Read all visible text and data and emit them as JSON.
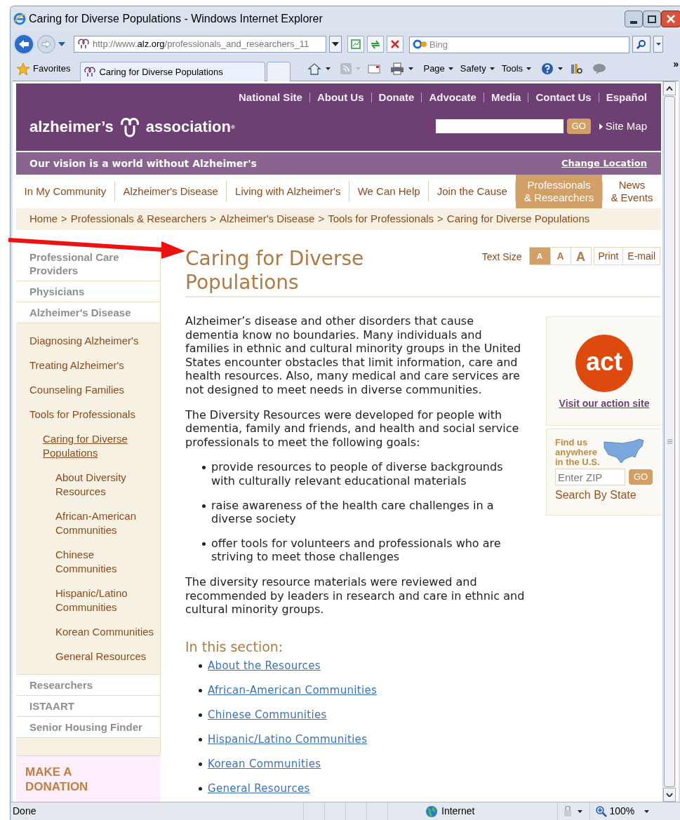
{
  "browser": {
    "title": "Caring for Diverse Populations - Windows Internet Explorer",
    "address_host": "http://www.",
    "address_domain": "alz.org",
    "address_path": "/professionals_and_researchers_11",
    "search_placeholder": "Bing",
    "favorites": "Favorites",
    "tab": "Caring for Diverse Populations",
    "menus": [
      "Page",
      "Safety",
      "Tools"
    ],
    "overflow": "»"
  },
  "header": {
    "top_links": [
      "National Site",
      "About Us",
      "Donate",
      "Advocate",
      "Media",
      "Contact Us",
      "Español"
    ],
    "logo_left": "alzheimer’s",
    "logo_right": "association",
    "logo_mark": "®",
    "search_button": "GO",
    "site_map": "Site Map",
    "vision": "Our vision is a world without Alzheimer's",
    "change_location": "Change Location"
  },
  "tabs": [
    {
      "lines": [
        "In My Community"
      ],
      "selected": false
    },
    {
      "lines": [
        "Alzheimer's Disease"
      ],
      "selected": false
    },
    {
      "lines": [
        "Living with Alzheimer's"
      ],
      "selected": false
    },
    {
      "lines": [
        "We Can Help"
      ],
      "selected": false
    },
    {
      "lines": [
        "Join the Cause"
      ],
      "selected": false
    },
    {
      "lines": [
        "Professionals",
        "& Researchers"
      ],
      "selected": true
    },
    {
      "lines": [
        "News",
        "& Events"
      ],
      "selected": false
    }
  ],
  "breadcrumb": {
    "separator": ">",
    "items": [
      "Home",
      "Professionals & Researchers",
      "Alzheimer's Disease",
      "Tools for Professionals",
      "Caring for Diverse Populations"
    ]
  },
  "sidebar": {
    "items": [
      {
        "label": "Professional Care Providers",
        "selected": false
      },
      {
        "label": "Physicians",
        "selected": false
      },
      {
        "label": "Alzheimer's Disease",
        "selected": false,
        "children": [
          {
            "label": "Diagnosing Alzheimer's",
            "selected": false
          },
          {
            "label": "Treating Alzheimer's",
            "selected": false
          },
          {
            "label": "Counseling Families",
            "selected": false
          },
          {
            "label": "Tools for Professionals",
            "selected": false,
            "children": [
              {
                "label": "Caring for Diverse Populations",
                "selected": true,
                "children": [
                  {
                    "label": "About Diversity Resources",
                    "selected": false
                  },
                  {
                    "label": "African-American Communities",
                    "selected": false
                  },
                  {
                    "label": "Chinese Communities",
                    "selected": false
                  },
                  {
                    "label": "Hispanic/Latino Communities",
                    "selected": false
                  },
                  {
                    "label": "Korean Communities",
                    "selected": false
                  },
                  {
                    "label": "General Resources",
                    "selected": false
                  }
                ]
              }
            ]
          }
        ]
      },
      {
        "label": "Researchers",
        "selected": false
      },
      {
        "label": "ISTAART",
        "selected": false
      },
      {
        "label": "Senior Housing Finder",
        "selected": false
      }
    ],
    "donation": "MAKE A DONATION"
  },
  "page": {
    "title": "Caring for Diverse Populations",
    "text_size": {
      "label": "Text Size",
      "sizes": [
        {
          "label": "A",
          "selected": true
        },
        {
          "label": "A",
          "selected": false
        },
        {
          "label": "A",
          "selected": false
        }
      ]
    },
    "actions": [
      "Print",
      "E-mail"
    ],
    "blocks": [
      {
        "kind": "paragraph",
        "text": "Alzheimer’s disease and other disorders that cause dementia know no boundaries. Many individuals and families in ethnic and cultural minority groups in the United States encounter obstacles that limit information, care and health resources. Also, many medical and care services are not designed to meet needs in diverse communities."
      },
      {
        "kind": "paragraph",
        "text": "The Diversity Resources were developed for people with dementia, family and friends, and health and social service professionals to meet the following goals:"
      },
      {
        "kind": "bullets",
        "items": [
          "provide resources to people of diverse backgrounds with culturally relevant educational materials",
          "raise awareness of the health care challenges in a diverse society",
          "offer tools for volunteers and professionals who are striving to meet those challenges"
        ]
      },
      {
        "kind": "paragraph",
        "text": "The diversity resource materials were reviewed and recommended by leaders in research and care in ethnic and cultural minority groups."
      }
    ],
    "section_heading": "In this section:",
    "section_links": [
      "About the Resources",
      "African-American Communities",
      "Chinese Communities",
      "Hispanic/Latino Communities",
      "Korean Communities",
      "General Resources"
    ]
  },
  "act": {
    "badge": "act",
    "link": "Visit our action site"
  },
  "finder": {
    "heading_lines": [
      "Find us",
      "anywhere",
      "in the U.S."
    ],
    "placeholder": "Enter ZIP",
    "button": "GO",
    "link": "Search By State"
  },
  "status_bar": {
    "text": "Done",
    "zone": "Internet",
    "zoom": "100%"
  }
}
